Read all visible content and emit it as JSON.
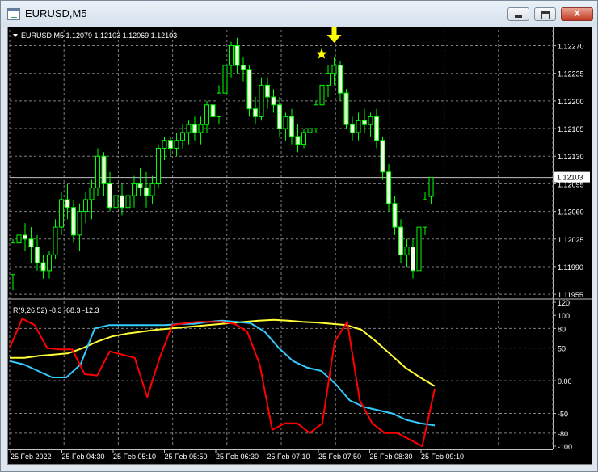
{
  "window": {
    "title": "EURUSD,M5",
    "buttons": {
      "minimize": "minimize",
      "maximize": "maximize",
      "close": "X"
    }
  },
  "colors": {
    "background": "#000000",
    "grid": "#7f7f7f",
    "candle_up": "#000000",
    "candle_up_border": "#00ff00",
    "candle_down": "#f0ffe0",
    "candle_wick": "#00ff00",
    "text": "#ffffff",
    "arrow": "#ffff00",
    "star": "#ffff00",
    "line_red": "#ff0000",
    "line_cyan": "#33ccff",
    "line_yellow": "#ffff33"
  },
  "main_panel": {
    "header": "EURUSD,M5  1.12079 1.12103 1.12069 1.12103",
    "price_labels": [
      "1.12270",
      "1.12235",
      "1.12200",
      "1.12165",
      "1.12130",
      "1.12095",
      "1.12060",
      "1.12025",
      "1.11990",
      "1.11955"
    ],
    "current_price": "1.12103",
    "markers": {
      "arrow_icon": "down-arrow-icon",
      "star_icon": "star-icon"
    }
  },
  "indicator_panel": {
    "header": "R(9,26,52) -8.3 -68.3 -12.3",
    "scale_labels": [
      "120",
      "100",
      "80",
      "50",
      "0.00",
      "-50",
      "-80",
      "-100"
    ],
    "series": [
      "red",
      "cyan",
      "yellow"
    ]
  },
  "time_labels": [
    "25 Feb 2022",
    "25 Feb 04:30",
    "25 Feb 05:10",
    "25 Feb 05:50",
    "25 Feb 06:30",
    "25 Feb 07:10",
    "25 Feb 07:50",
    "25 Feb 08:30",
    "25 Feb 09:10"
  ],
  "chart_data": {
    "type": "candlestick",
    "symbol": "EURUSD",
    "timeframe": "M5",
    "ylim": [
      1.1195,
      1.1229
    ],
    "candles": [
      [
        1.1198,
        1.12025,
        1.1196,
        1.1202
      ],
      [
        1.1202,
        1.1204,
        1.12,
        1.1203
      ],
      [
        1.1203,
        1.12045,
        1.1201,
        1.12025
      ],
      [
        1.12025,
        1.1204,
        1.11995,
        1.12015
      ],
      [
        1.12015,
        1.1203,
        1.11985,
        1.11995
      ],
      [
        1.11995,
        1.12005,
        1.11975,
        1.11985
      ],
      [
        1.11985,
        1.1201,
        1.11975,
        1.12005
      ],
      [
        1.12005,
        1.1205,
        1.12,
        1.1204
      ],
      [
        1.1204,
        1.12085,
        1.1203,
        1.12075
      ],
      [
        1.12075,
        1.12095,
        1.1205,
        1.12065
      ],
      [
        1.12065,
        1.12075,
        1.1202,
        1.1203
      ],
      [
        1.1203,
        1.1207,
        1.1201,
        1.1206
      ],
      [
        1.1206,
        1.12085,
        1.12045,
        1.12075
      ],
      [
        1.12075,
        1.121,
        1.1205,
        1.1209
      ],
      [
        1.1209,
        1.1214,
        1.1208,
        1.1213
      ],
      [
        1.1213,
        1.12135,
        1.1208,
        1.12095
      ],
      [
        1.12095,
        1.1211,
        1.1206,
        1.12065
      ],
      [
        1.12065,
        1.1209,
        1.12055,
        1.1208
      ],
      [
        1.1208,
        1.12095,
        1.12055,
        1.12065
      ],
      [
        1.12065,
        1.12085,
        1.1205,
        1.1208
      ],
      [
        1.1208,
        1.12105,
        1.12065,
        1.12095
      ],
      [
        1.12095,
        1.12115,
        1.1208,
        1.1209
      ],
      [
        1.1209,
        1.1211,
        1.12065,
        1.1208
      ],
      [
        1.1208,
        1.12105,
        1.1207,
        1.12095
      ],
      [
        1.12095,
        1.12145,
        1.1209,
        1.1214
      ],
      [
        1.1214,
        1.12155,
        1.12125,
        1.1215
      ],
      [
        1.1215,
        1.12155,
        1.1213,
        1.1214
      ],
      [
        1.1214,
        1.1216,
        1.1213,
        1.1215
      ],
      [
        1.1215,
        1.1217,
        1.1214,
        1.1216
      ],
      [
        1.1216,
        1.12175,
        1.12145,
        1.1217
      ],
      [
        1.1217,
        1.1218,
        1.1215,
        1.1216
      ],
      [
        1.1216,
        1.1218,
        1.12145,
        1.1217
      ],
      [
        1.1217,
        1.122,
        1.1216,
        1.12195
      ],
      [
        1.12195,
        1.1221,
        1.1217,
        1.1218
      ],
      [
        1.1218,
        1.1222,
        1.1217,
        1.1221
      ],
      [
        1.1221,
        1.1225,
        1.122,
        1.12245
      ],
      [
        1.12245,
        1.12275,
        1.1223,
        1.1227
      ],
      [
        1.1227,
        1.1228,
        1.12235,
        1.12245
      ],
      [
        1.12245,
        1.12255,
        1.12225,
        1.1224
      ],
      [
        1.1224,
        1.12245,
        1.1218,
        1.1219
      ],
      [
        1.1219,
        1.12205,
        1.1217,
        1.1218
      ],
      [
        1.1218,
        1.1223,
        1.12175,
        1.1222
      ],
      [
        1.1222,
        1.1223,
        1.1219,
        1.12205
      ],
      [
        1.12205,
        1.12215,
        1.12185,
        1.12195
      ],
      [
        1.12195,
        1.12205,
        1.12155,
        1.12165
      ],
      [
        1.12165,
        1.12185,
        1.1215,
        1.1218
      ],
      [
        1.1218,
        1.1219,
        1.12145,
        1.12155
      ],
      [
        1.12155,
        1.1217,
        1.12135,
        1.12145
      ],
      [
        1.12145,
        1.12165,
        1.1214,
        1.1216
      ],
      [
        1.1216,
        1.12175,
        1.1215,
        1.12165
      ],
      [
        1.12165,
        1.122,
        1.1216,
        1.12195
      ],
      [
        1.12195,
        1.1223,
        1.12185,
        1.1222
      ],
      [
        1.1222,
        1.12245,
        1.12205,
        1.12235
      ],
      [
        1.12235,
        1.12255,
        1.1222,
        1.12245
      ],
      [
        1.12245,
        1.1225,
        1.122,
        1.1221
      ],
      [
        1.1221,
        1.12215,
        1.12165,
        1.1217
      ],
      [
        1.1217,
        1.1218,
        1.1215,
        1.1216
      ],
      [
        1.1216,
        1.12185,
        1.1215,
        1.12175
      ],
      [
        1.12175,
        1.1219,
        1.1216,
        1.1217
      ],
      [
        1.1217,
        1.12185,
        1.12155,
        1.1218
      ],
      [
        1.1218,
        1.1219,
        1.1214,
        1.1215
      ],
      [
        1.1215,
        1.12155,
        1.121,
        1.1211
      ],
      [
        1.1211,
        1.1212,
        1.1206,
        1.1207
      ],
      [
        1.1207,
        1.1208,
        1.1203,
        1.1204
      ],
      [
        1.1204,
        1.1205,
        1.11995,
        1.12005
      ],
      [
        1.12005,
        1.12025,
        1.1199,
        1.12015
      ],
      [
        1.12015,
        1.12025,
        1.11975,
        1.11985
      ],
      [
        1.11985,
        1.12045,
        1.11965,
        1.1204
      ],
      [
        1.1204,
        1.12085,
        1.1203,
        1.12075
      ],
      [
        1.12079,
        1.12103,
        1.12069,
        1.12103
      ]
    ],
    "indicator": {
      "name": "R(9,26,52)",
      "values_last": [
        -8.3,
        -68.3,
        -12.3
      ],
      "ylim": [
        -100,
        120
      ],
      "red": [
        50,
        95,
        85,
        50,
        48,
        48,
        10,
        8,
        45,
        40,
        35,
        -25,
        35,
        85,
        88,
        90,
        90,
        90,
        87,
        75,
        25,
        -75,
        -65,
        -65,
        -80,
        -65,
        60,
        90,
        -30,
        -65,
        -80,
        -80,
        -90,
        -100,
        -12.3
      ],
      "cyan": [
        30,
        25,
        15,
        5,
        5,
        25,
        80,
        85,
        85,
        85,
        85,
        85,
        87,
        87,
        90,
        92,
        90,
        88,
        75,
        50,
        30,
        20,
        15,
        -5,
        -30,
        -40,
        -45,
        -50,
        -60,
        -65,
        -68.3
      ],
      "yellow": [
        35,
        35,
        38,
        40,
        42,
        50,
        60,
        68,
        72,
        75,
        78,
        80,
        82,
        84,
        86,
        88,
        90,
        92,
        93,
        92,
        90,
        89,
        87,
        85,
        78,
        60,
        40,
        20,
        5,
        -8.3
      ]
    }
  }
}
